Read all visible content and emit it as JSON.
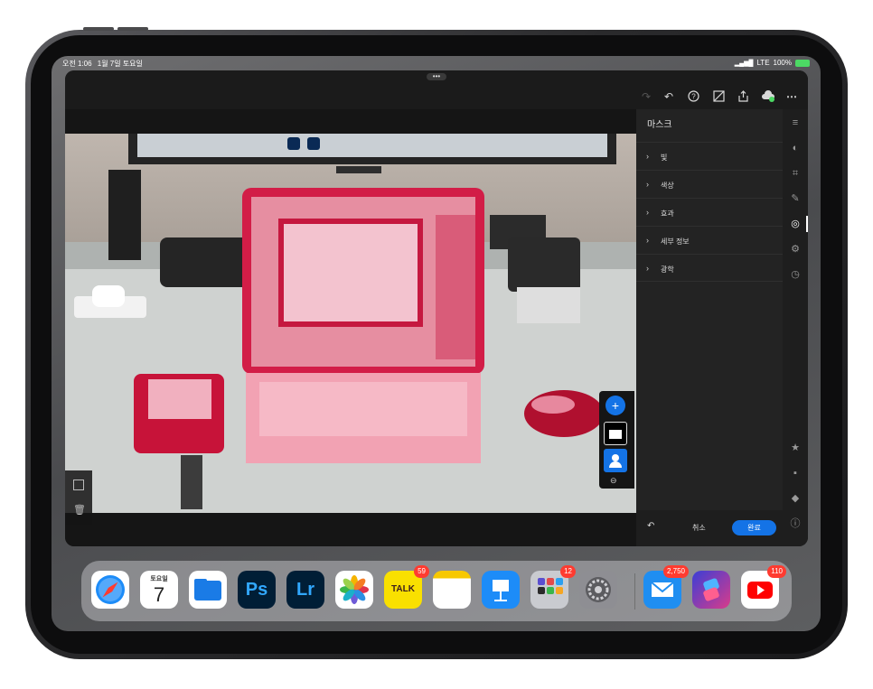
{
  "status": {
    "time": "오전 1:06",
    "date": "1월 7일 토요일",
    "signal": "LTE",
    "battery": "100%"
  },
  "toolbar": {
    "redo": "redo-icon",
    "undo": "undo-icon",
    "help": "help-icon",
    "compare": "compare-icon",
    "share": "share-icon",
    "cloud": "cloud-sync-icon",
    "more": "⋯"
  },
  "panel": {
    "title": "마스크",
    "items": [
      {
        "label": "빛"
      },
      {
        "label": "색상"
      },
      {
        "label": "효과"
      },
      {
        "label": "세부 정보"
      },
      {
        "label": "광학"
      }
    ]
  },
  "bottom": {
    "cancel": "취소",
    "done": "완료"
  },
  "dock": {
    "calendar_day": "토요일",
    "calendar_date": "7",
    "apps": [
      {
        "name": "Safari"
      },
      {
        "name": "Calendar"
      },
      {
        "name": "Files"
      },
      {
        "name": "Ps"
      },
      {
        "name": "Lr"
      },
      {
        "name": "Photos"
      },
      {
        "name": "TALK",
        "badge": "59"
      },
      {
        "name": "Notes"
      },
      {
        "name": "Keynote"
      },
      {
        "name": "Folder",
        "badge": "12"
      },
      {
        "name": "Settings"
      },
      {
        "name": "Mail",
        "badge": "2,750"
      },
      {
        "name": "Shortcuts"
      },
      {
        "name": "YouTube",
        "badge": "110"
      }
    ]
  },
  "colors": {
    "accent": "#1473e6",
    "mask_overlay": "#e0204a",
    "badge": "#ff3b30"
  }
}
